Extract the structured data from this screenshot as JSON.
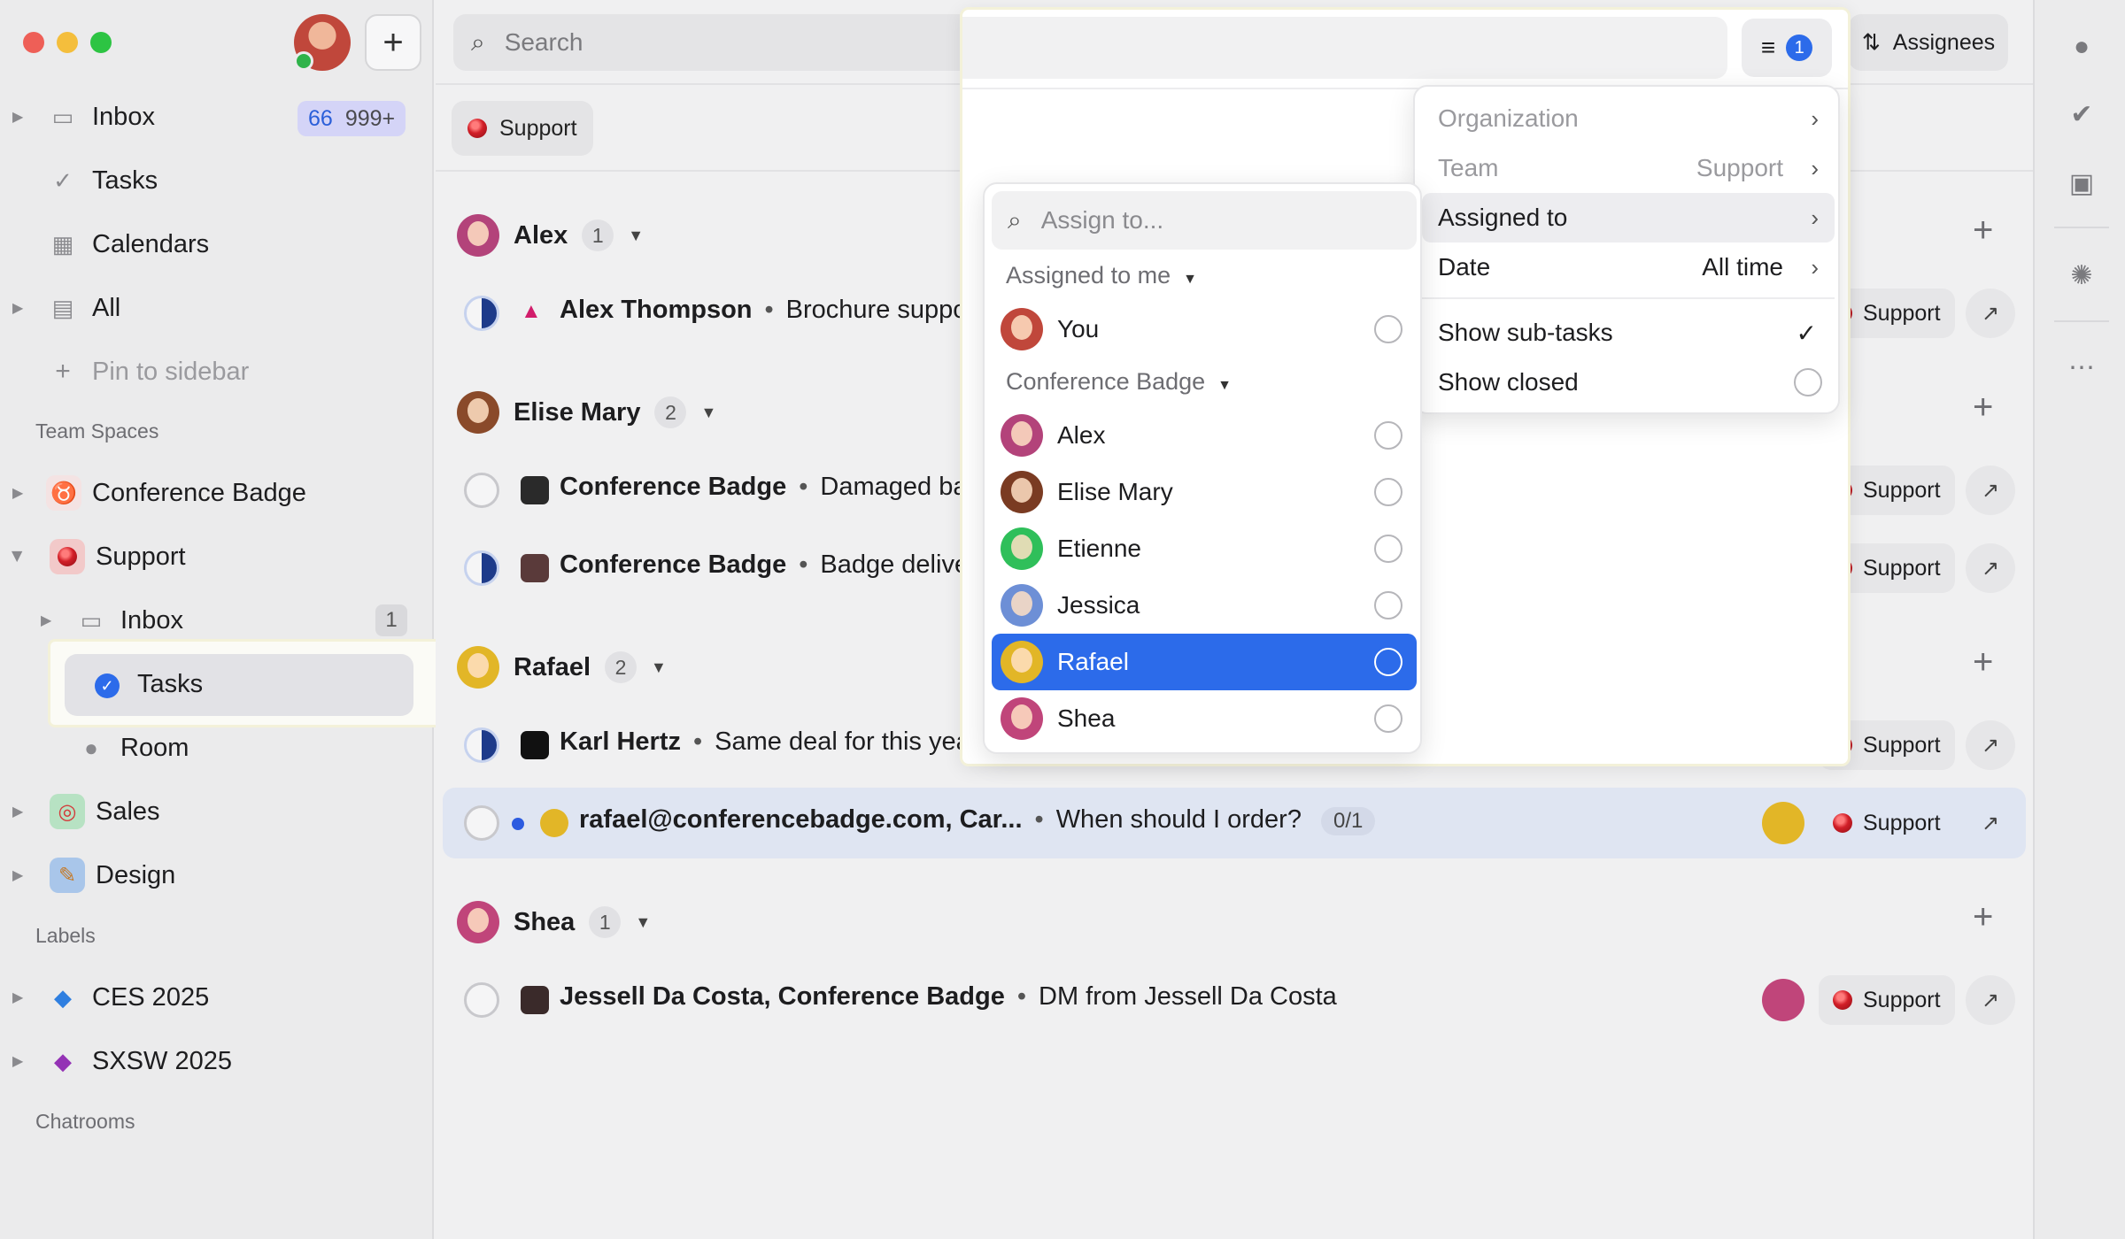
{
  "sidebar": {
    "inbox": {
      "label": "Inbox",
      "unread": "66",
      "total": "999+"
    },
    "tasks": "Tasks",
    "calendars": "Calendars",
    "all": "All",
    "pin": "Pin to sidebar",
    "team_spaces_label": "Team Spaces",
    "spaces": [
      {
        "label": "Conference Badge"
      },
      {
        "label": "Support",
        "children": [
          {
            "label": "Inbox",
            "count": "1"
          },
          {
            "label": "Tasks"
          },
          {
            "label": "Room"
          }
        ]
      },
      {
        "label": "Sales"
      },
      {
        "label": "Design"
      }
    ],
    "labels_label": "Labels",
    "labels": [
      {
        "label": "CES 2025"
      },
      {
        "label": "SXSW 2025"
      }
    ],
    "chatrooms_label": "Chatrooms"
  },
  "topbar": {
    "search_placeholder": "Search",
    "filter_count": "1",
    "assignees": "Assignees"
  },
  "filter_chip": "Support",
  "groups": [
    {
      "name": "Alex",
      "count": "1",
      "tasks": [
        {
          "contact": "Alex Thompson",
          "subject": "Brochure support?",
          "chip": "Support"
        }
      ]
    },
    {
      "name": "Elise Mary",
      "count": "2",
      "tasks": [
        {
          "contact": "Conference Badge",
          "subject": "Damaged badge",
          "chip": "Support"
        },
        {
          "contact": "Conference Badge",
          "subject": "Badge delivery",
          "chip": "Support"
        }
      ]
    },
    {
      "name": "Rafael",
      "count": "2",
      "tasks": [
        {
          "contact": "Karl Hertz",
          "subject": "Same deal for this year?",
          "chip": "Support"
        },
        {
          "contact": "rafael@conferencebadge.com, Car...",
          "subject": "When should I order?",
          "progress": "0/1",
          "chip": "Support"
        }
      ]
    },
    {
      "name": "Shea",
      "count": "1",
      "tasks": [
        {
          "contact": "Jessell Da Costa, Conference Badge",
          "subject": "DM from Jessell Da Costa",
          "chip": "Support"
        }
      ]
    }
  ],
  "filter_menu": {
    "items": [
      {
        "label": "Organization",
        "value": ""
      },
      {
        "label": "Team",
        "value": "Support"
      },
      {
        "label": "Assigned to",
        "value": ""
      },
      {
        "label": "Date",
        "value": "All time"
      }
    ],
    "show_subtasks": {
      "label": "Show sub-tasks",
      "checked": true
    },
    "show_closed": {
      "label": "Show closed",
      "checked": false
    }
  },
  "assign_popover": {
    "placeholder": "Assign to...",
    "group_me": "Assigned to me",
    "me": "You",
    "group_team": "Conference Badge",
    "members": [
      "Alex",
      "Elise Mary",
      "Etienne",
      "Jessica",
      "Rafael",
      "Shea"
    ],
    "highlighted": "Rafael"
  },
  "colors": {
    "accent": "#2c6bea",
    "support_red": "#d21f28"
  }
}
